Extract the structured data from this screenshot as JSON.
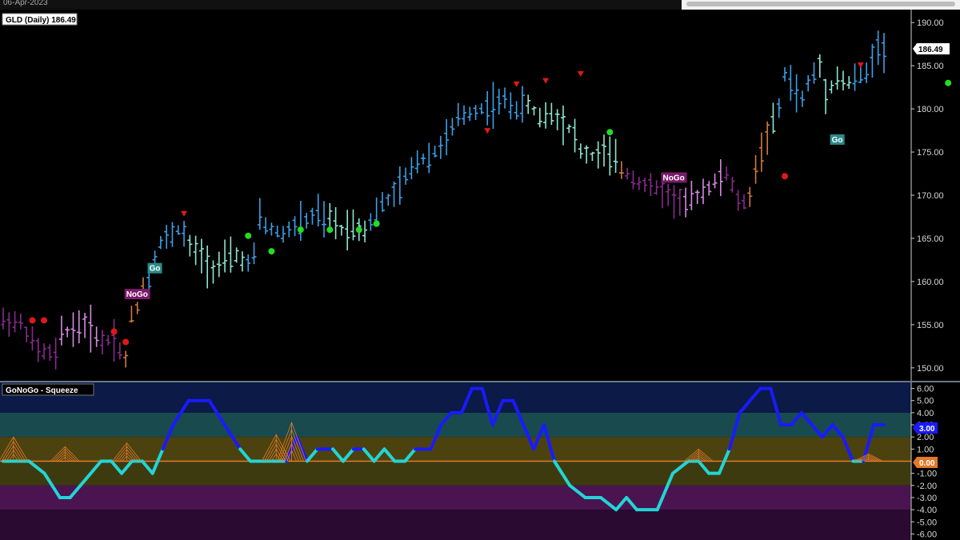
{
  "header": {
    "date": "06-Apr-2023"
  },
  "colors": {
    "bg": "#000000",
    "strong_go": "#3aa0e8",
    "go": "#8ee6d0",
    "nogo": "#d58be0",
    "strong_nogo": "#8a2a8f",
    "amber": "#d07a3a",
    "green_dot": "#22dd22",
    "red_dot": "#e01818",
    "osc_positive": "#1a1aff",
    "osc_negative": "#22d5d5",
    "squeeze": "#e07a2a"
  },
  "chart_data": [
    {
      "type": "ohlc",
      "title": "GLD (Daily) 186.49",
      "last_price_label": "186.49",
      "ylim": [
        148.5,
        191.5
      ],
      "yticks": [
        "190.00",
        "185.00",
        "180.00",
        "175.00",
        "170.00",
        "165.00",
        "160.00",
        "155.00",
        "150.00"
      ],
      "n_bars": 95,
      "segments": [
        {
          "color": "strong_nogo",
          "points": [
            [
              0,
              155.5
            ],
            [
              3,
              155.2
            ],
            [
              6,
              152
            ],
            [
              9,
              151.5
            ],
            [
              10,
              154
            ]
          ]
        },
        {
          "color": "nogo",
          "points": [
            [
              10,
              154
            ],
            [
              12,
              154.5
            ],
            [
              14,
              155
            ],
            [
              15,
              154.5
            ],
            [
              17,
              153
            ]
          ]
        },
        {
          "color": "strong_nogo",
          "points": [
            [
              17,
              153
            ],
            [
              19,
              153.5
            ],
            [
              20,
              152
            ],
            [
              21,
              151
            ]
          ]
        },
        {
          "color": "amber",
          "points": [
            [
              21,
              151
            ],
            [
              22,
              156
            ],
            [
              23,
              157
            ],
            [
              24,
              159.5
            ],
            [
              25,
              160
            ]
          ]
        },
        {
          "color": "strong_go",
          "points": [
            [
              25,
              160
            ],
            [
              26,
              163
            ],
            [
              27,
              164.5
            ],
            [
              28,
              165
            ],
            [
              29,
              165.5
            ],
            [
              30,
              166
            ],
            [
              31,
              165.5
            ],
            [
              32,
              164
            ]
          ]
        },
        {
          "color": "go",
          "points": [
            [
              32,
              164
            ],
            [
              34,
              163
            ],
            [
              35,
              162
            ],
            [
              36,
              161.5
            ],
            [
              38,
              162.5
            ],
            [
              40,
              163
            ],
            [
              41,
              162.5
            ],
            [
              42,
              162
            ]
          ]
        },
        {
          "color": "strong_go",
          "points": [
            [
              42,
              162
            ],
            [
              43,
              163
            ],
            [
              44,
              167.5
            ],
            [
              45,
              166.5
            ],
            [
              46,
              166
            ],
            [
              48,
              165.5
            ],
            [
              50,
              166.5
            ],
            [
              52,
              167
            ],
            [
              54,
              168
            ],
            [
              55,
              167
            ],
            [
              56,
              167.5
            ]
          ]
        },
        {
          "color": "go",
          "points": [
            [
              56,
              167.5
            ],
            [
              58,
              166
            ],
            [
              60,
              166.5
            ],
            [
              62,
              166
            ],
            [
              63,
              167
            ]
          ]
        },
        {
          "color": "strong_go",
          "points": [
            [
              63,
              167
            ],
            [
              65,
              169
            ],
            [
              67,
              170
            ],
            [
              69,
              172
            ],
            [
              71,
              174
            ],
            [
              73,
              174.5
            ],
            [
              74,
              175
            ],
            [
              76,
              176.5
            ],
            [
              78,
              179
            ],
            [
              80,
              179.5
            ],
            [
              82,
              180
            ],
            [
              84,
              180.5
            ],
            [
              86,
              181
            ],
            [
              88,
              180
            ],
            [
              90,
              180.5
            ]
          ]
        },
        {
          "color": "go",
          "points": [
            [
              90,
              180.5
            ],
            [
              92,
              179
            ],
            [
              94,
              179.5
            ],
            [
              96,
              178.5
            ],
            [
              98,
              177
            ]
          ]
        }
      ],
      "markers": [
        {
          "bar": 5,
          "price": 155.5,
          "kind": "red_dot"
        },
        {
          "bar": 7,
          "price": 155.5,
          "kind": "red_dot"
        },
        {
          "bar": 19,
          "price": 154.2,
          "kind": "red_dot"
        },
        {
          "bar": 21,
          "price": 153.0,
          "kind": "red_dot"
        },
        {
          "bar": 31,
          "price": 167.8,
          "kind": "red_tri"
        },
        {
          "bar": 42,
          "price": 165.3,
          "kind": "green_dot"
        },
        {
          "bar": 46,
          "price": 163.5,
          "kind": "green_dot"
        },
        {
          "bar": 51,
          "price": 166.0,
          "kind": "green_dot"
        },
        {
          "bar": 56,
          "price": 166.0,
          "kind": "green_dot"
        },
        {
          "bar": 61,
          "price": 166.0,
          "kind": "green_dot"
        },
        {
          "bar": 64,
          "price": 166.7,
          "kind": "green_dot"
        }
      ],
      "labels": [
        {
          "bar": 23,
          "price": 158.5,
          "text": "NoGo",
          "kind": "nogo"
        },
        {
          "bar": 26,
          "price": 161.5,
          "text": "Go",
          "kind": "go"
        }
      ]
    },
    {
      "type": "line",
      "title": "GoNoGo - Squeeze",
      "last_value_label": "3.00",
      "zero_label": "0.00",
      "ylim": [
        -6.5,
        6.5
      ],
      "yticks": [
        "6.00",
        "5.00",
        "4.00",
        "3.00",
        "2.00",
        "1.00",
        "-1.00",
        "-2.00",
        "-3.00",
        "-4.00",
        "-5.00",
        "-6.00"
      ],
      "bands": [
        {
          "from": 4,
          "to": 6.5,
          "color": "#0b1a46"
        },
        {
          "from": 2,
          "to": 4,
          "color": "#184a4e"
        },
        {
          "from": 0,
          "to": 2,
          "color": "#4c4210"
        },
        {
          "from": -2,
          "to": 0,
          "color": "#3e3a10"
        },
        {
          "from": -4,
          "to": -2,
          "color": "#4a1450"
        },
        {
          "from": -6.5,
          "to": -4,
          "color": "#2a0a30"
        }
      ]
    }
  ],
  "footer": {}
}
